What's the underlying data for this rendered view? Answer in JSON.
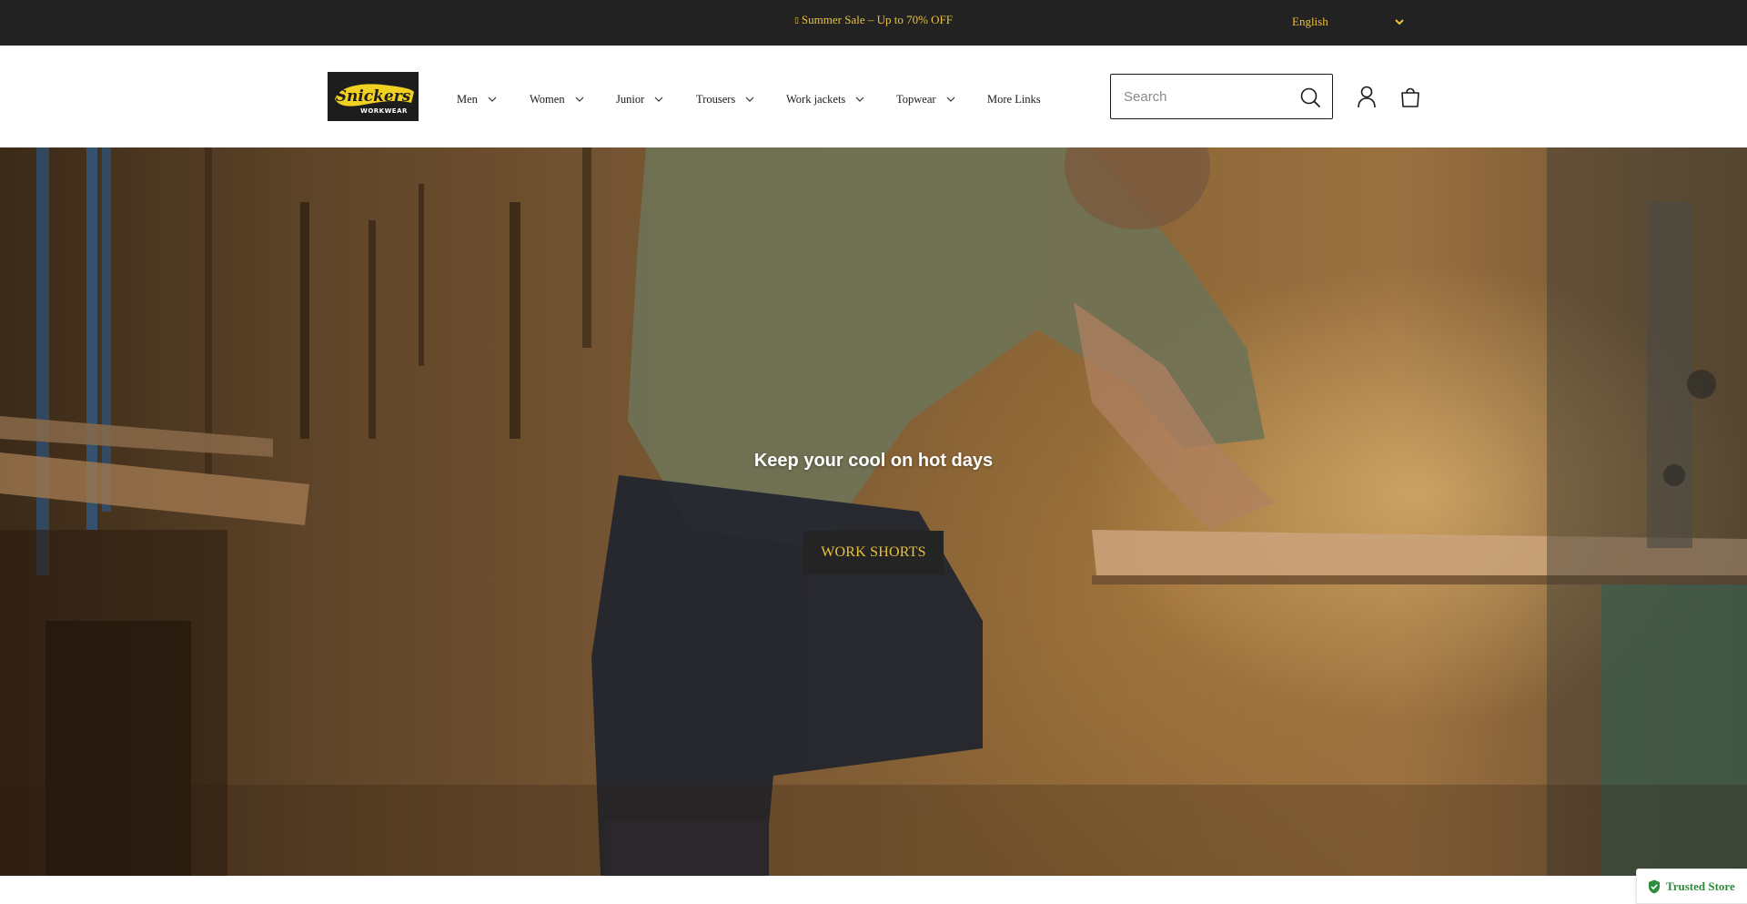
{
  "announcement": {
    "icon": "tag-icon",
    "text": "Summer Sale – Up to 70% OFF"
  },
  "language": {
    "selected": "English"
  },
  "logo": {
    "brand": "Snickers",
    "sub": "WORKWEAR"
  },
  "nav": {
    "items": [
      {
        "label": "Men",
        "has_dropdown": true
      },
      {
        "label": "Women",
        "has_dropdown": true
      },
      {
        "label": "Junior",
        "has_dropdown": true
      },
      {
        "label": "Trousers",
        "has_dropdown": true
      },
      {
        "label": "Work jackets",
        "has_dropdown": true
      },
      {
        "label": "Topwear",
        "has_dropdown": true
      },
      {
        "label": "More Links",
        "has_dropdown": false
      }
    ]
  },
  "search": {
    "placeholder": "Search",
    "value": ""
  },
  "hero": {
    "heading": "Keep your cool on hot days",
    "button_label": "WORK SHORTS"
  },
  "trusted_badge": {
    "label": "Trusted Store"
  },
  "colors": {
    "accent_yellow": "#e9c23c",
    "topbar_bg": "#222222",
    "button_bg": "#242424",
    "trusted_green": "#2e8b3c"
  }
}
